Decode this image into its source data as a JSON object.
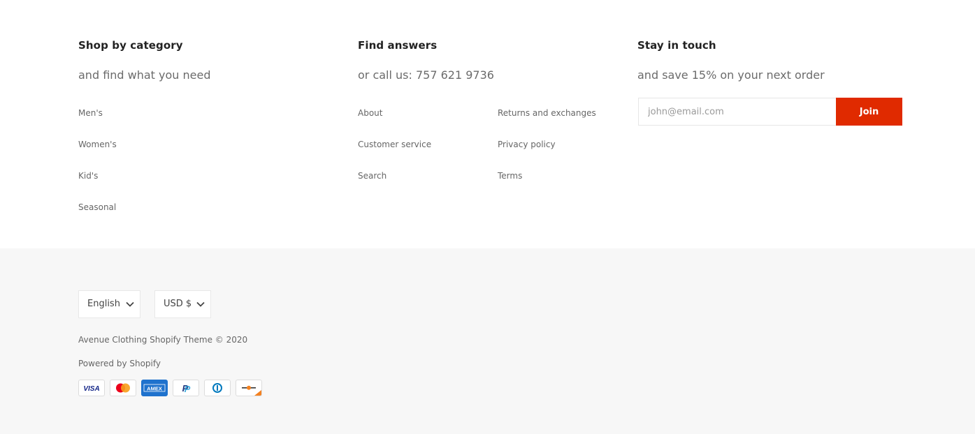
{
  "shop": {
    "title": "Shop by category",
    "subtitle": "and find what you need",
    "links": [
      "Men's",
      "Women's",
      "Kid's",
      "Seasonal"
    ]
  },
  "answers": {
    "title": "Find answers",
    "subtitle": "or call us: 757 621 9736",
    "links_left": [
      "About",
      "Customer service",
      "Search"
    ],
    "links_right": [
      "Returns and exchanges",
      "Privacy policy",
      "Terms"
    ]
  },
  "newsletter": {
    "title": "Stay in touch",
    "subtitle": "and save 15% on your next order",
    "placeholder": "john@email.com",
    "button_label": "Join"
  },
  "locale": {
    "language": "English",
    "currency": "USD $"
  },
  "legal": {
    "copyright": "Avenue Clothing Shopify Theme © 2020",
    "powered_by": "Powered by Shopify"
  },
  "payment_icons": [
    "visa-icon",
    "mastercard-icon",
    "amex-icon",
    "paypal-icon",
    "diners-club-icon",
    "discover-icon"
  ],
  "colors": {
    "accent": "#e02a00",
    "bottom_background": "#f7f7f7",
    "text_muted": "#666666"
  }
}
